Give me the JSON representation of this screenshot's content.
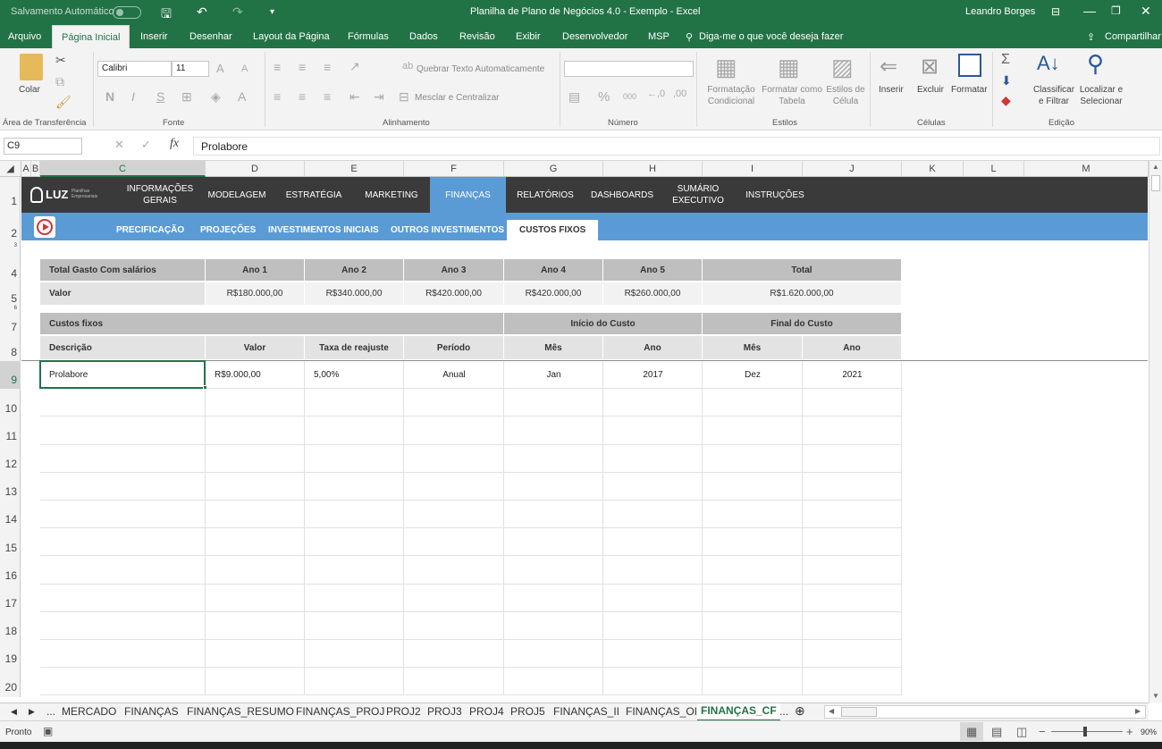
{
  "titlebar": {
    "autosave": "Salvamento Automático",
    "title": "Planilha de Plano de Negócios 4.0 - Exemplo  -  Excel",
    "user": "Leandro Borges"
  },
  "ribbon_tabs": [
    "Arquivo",
    "Página Inicial",
    "Inserir",
    "Desenhar",
    "Layout da Página",
    "Fórmulas",
    "Dados",
    "Revisão",
    "Exibir",
    "Desenvolvedor",
    "MSP"
  ],
  "tell_me": "Diga-me o que você deseja fazer",
  "share": "Compartilhar",
  "ribbon": {
    "paste": "Colar",
    "clipboard": "Área de Transferência",
    "font_name": "Calibri",
    "font_size": "11",
    "font_group": "Fonte",
    "bold": "N",
    "italic": "I",
    "underline": "S",
    "wrap": "Quebrar Texto Automaticamente",
    "merge": "Mesclar e Centralizar",
    "alignment": "Alinhamento",
    "percent": "%",
    "thousands": "000",
    "number": "Número",
    "cond_format": "Formatação Condicional",
    "format_table": "Formatar como Tabela",
    "cell_styles": "Estilos de Célula",
    "styles": "Estilos",
    "insert": "Inserir",
    "delete": "Excluir",
    "format": "Formatar",
    "cells": "Células",
    "sort_filter": "Classificar e Filtrar",
    "find_select": "Localizar e Selecionar",
    "editing": "Edição"
  },
  "formula_bar": {
    "name_box": "C9",
    "fx": "fx",
    "value": "Prolabore"
  },
  "columns": [
    "A",
    "B",
    "C",
    "D",
    "E",
    "F",
    "G",
    "H",
    "I",
    "J",
    "K",
    "L",
    "M"
  ],
  "rows": [
    "1",
    "2",
    "3",
    "4",
    "5",
    "6",
    "7",
    "8",
    "9",
    "10",
    "11",
    "12",
    "13",
    "14",
    "15",
    "16",
    "17",
    "18",
    "19",
    "20"
  ],
  "nav": {
    "logo": "LUZ",
    "logo_sub": "Planilhas Empresariais",
    "items": [
      "INFORMAÇÕES GERAIS",
      "MODELAGEM",
      "ESTRATÉGIA",
      "MARKETING",
      "FINANÇAS",
      "RELATÓRIOS",
      "DASHBOARDS",
      "SUMÁRIO EXECUTIVO",
      "INSTRUÇÕES"
    ]
  },
  "subnav": [
    "PRECIFICAÇÃO",
    "PROJEÇÕES",
    "INVESTIMENTOS INICIAIS",
    "OUTROS INVESTIMENTOS",
    "CUSTOS FIXOS"
  ],
  "salary_table": {
    "label": "Total Gasto Com salários",
    "years": [
      "Ano 1",
      "Ano 2",
      "Ano 3",
      "Ano 4",
      "Ano 5"
    ],
    "total_label": "Total",
    "row_label": "Valor",
    "values": [
      "R$180.000,00",
      "R$340.000,00",
      "R$420.000,00",
      "R$420.000,00",
      "R$260.000,00"
    ],
    "total": "R$1.620.000,00"
  },
  "costs_table": {
    "title": "Custos fixos",
    "start": "Início do Custo",
    "end": "Final do Custo",
    "headers": [
      "Descrição",
      "Valor",
      "Taxa de reajuste",
      "Período",
      "Mês",
      "Ano",
      "Mês",
      "Ano"
    ],
    "rows": [
      [
        "Prolabore",
        "R$9.000,00",
        "5,00%",
        "Anual",
        "Jan",
        "2017",
        "Dez",
        "2021"
      ]
    ]
  },
  "sheet_tabs": [
    "MERCADO",
    "FINANÇAS",
    "FINANÇAS_RESUMO",
    "FINANÇAS_PROJ",
    "PROJ2",
    "PROJ3",
    "PROJ4",
    "PROJ5",
    "FINANÇAS_II",
    "FINANÇAS_OI",
    "FINANÇAS_CF",
    "..."
  ],
  "status": {
    "ready": "Pronto",
    "zoom": "90%"
  }
}
